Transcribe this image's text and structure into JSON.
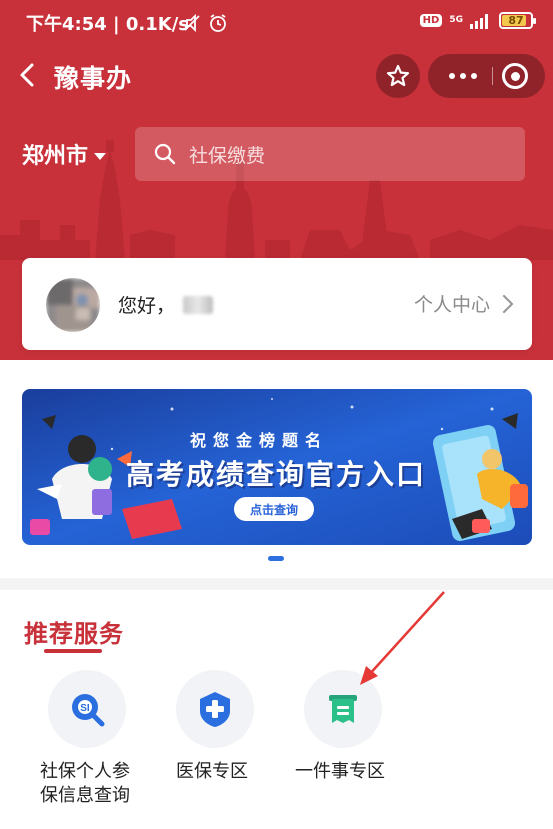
{
  "status_bar": {
    "time_speed": "下午4:54 | 0.1K/s",
    "hd_badge": "HD",
    "network": "5G",
    "battery_level": "87"
  },
  "nav": {
    "title": "豫事办"
  },
  "search": {
    "city": "郑州市",
    "placeholder": "社保缴费"
  },
  "user_card": {
    "greeting": "您好，",
    "link_label": "个人中心"
  },
  "banner": {
    "subtitle": "祝您金榜题名",
    "title": "高考成绩查询官方入口",
    "button_label": "点击查询"
  },
  "services_section": {
    "title": "推荐服务",
    "items": [
      {
        "label": "社保个人参保信息查询",
        "icon": "social-security-icon",
        "color": "#2a6ee0"
      },
      {
        "label": "医保专区",
        "icon": "medical-insurance-icon",
        "color": "#2a6ee0"
      },
      {
        "label": "一件事专区",
        "icon": "one-thing-icon",
        "color": "#2bbf8a"
      }
    ]
  },
  "colors": {
    "brand_red": "#c8313a",
    "accent_blue": "#2a6ee0"
  }
}
